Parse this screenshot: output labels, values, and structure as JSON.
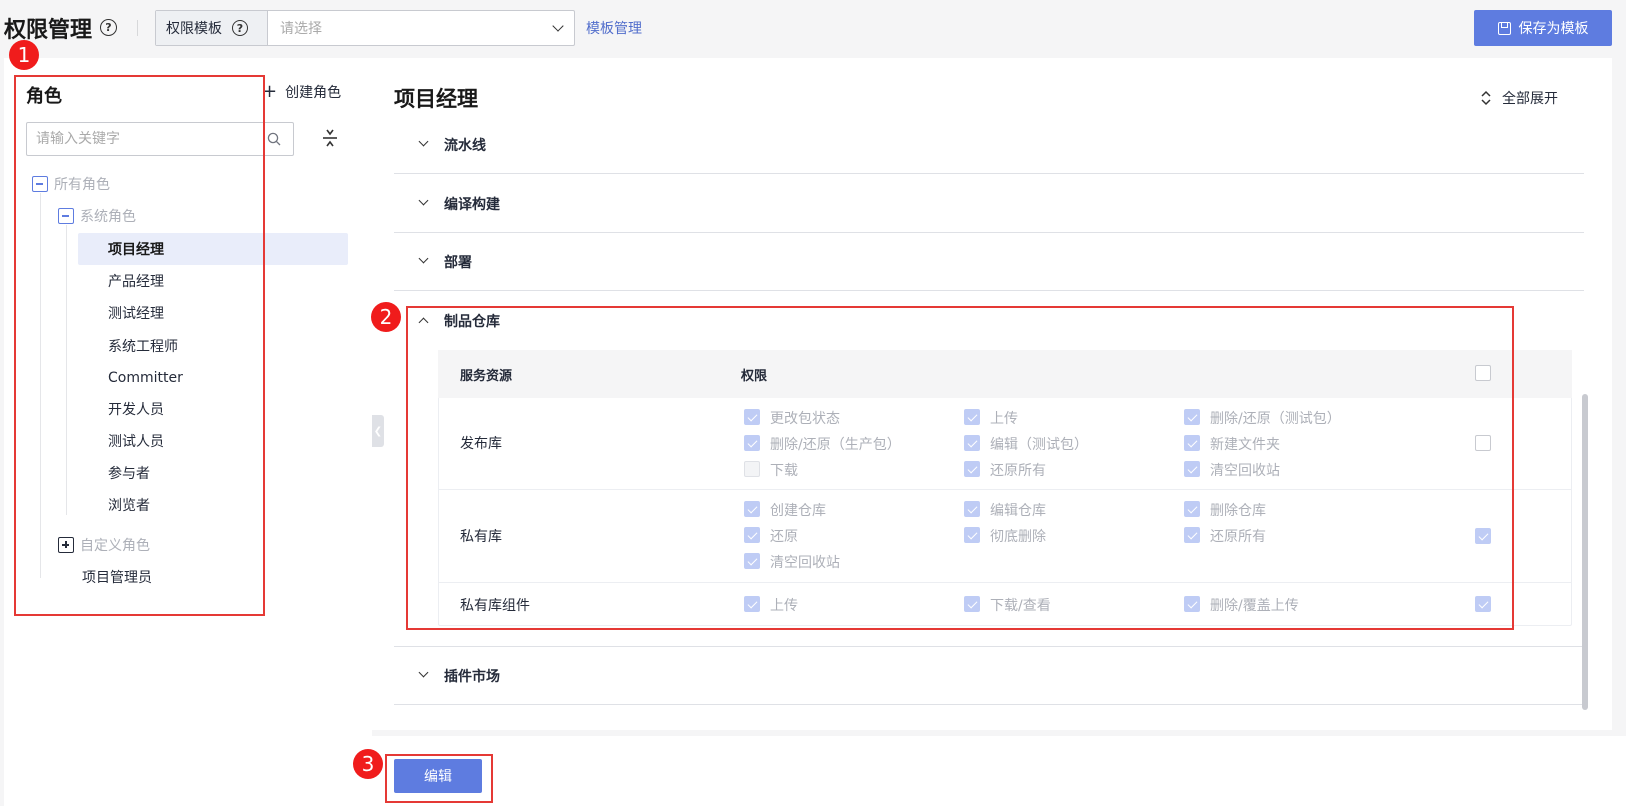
{
  "header": {
    "title": "权限管理",
    "template_label": "权限模板",
    "template_placeholder": "请选择",
    "template_manage": "模板管理",
    "save_as_template": "保存为模板"
  },
  "roles": {
    "title": "角色",
    "create_role": "创建角色",
    "search_placeholder": "请输入关键字",
    "root": "所有角色",
    "system_group": "系统角色",
    "system_roles": [
      "项目经理",
      "产品经理",
      "测试经理",
      "系统工程师",
      "Committer",
      "开发人员",
      "测试人员",
      "参与者",
      "浏览者"
    ],
    "selected_role": "项目经理",
    "custom_group": "自定义角色",
    "project_admin": "项目管理员"
  },
  "permissions": {
    "title": "项目经理",
    "expand_all": "全部展开",
    "sections": [
      "流水线",
      "编译构建",
      "部署",
      "制品仓库",
      "插件市场"
    ],
    "open_section": "制品仓库",
    "table_headers": [
      "服务资源",
      "权限"
    ],
    "rows": [
      {
        "resource": "发布库",
        "all_checked": false,
        "perms": [
          {
            "label": "更改包状态",
            "checked": true
          },
          {
            "label": "上传",
            "checked": true
          },
          {
            "label": "删除/还原（测试包）",
            "checked": true
          },
          {
            "label": "删除/还原（生产包）",
            "checked": true
          },
          {
            "label": "编辑（测试包）",
            "checked": true
          },
          {
            "label": "新建文件夹",
            "checked": true
          },
          {
            "label": "下载",
            "checked": false
          },
          {
            "label": "还原所有",
            "checked": true
          },
          {
            "label": "清空回收站",
            "checked": true
          }
        ]
      },
      {
        "resource": "私有库",
        "all_checked": true,
        "perms": [
          {
            "label": "创建仓库",
            "checked": true
          },
          {
            "label": "编辑仓库",
            "checked": true
          },
          {
            "label": "删除仓库",
            "checked": true
          },
          {
            "label": "还原",
            "checked": true
          },
          {
            "label": "彻底删除",
            "checked": true
          },
          {
            "label": "还原所有",
            "checked": true
          },
          {
            "label": "清空回收站",
            "checked": true
          }
        ]
      },
      {
        "resource": "私有库组件",
        "all_checked": true,
        "perms": [
          {
            "label": "上传",
            "checked": true
          },
          {
            "label": "下载/查看",
            "checked": true
          },
          {
            "label": "删除/覆盖上传",
            "checked": true
          }
        ]
      }
    ],
    "header_all_checked": false
  },
  "footer": {
    "edit": "编辑"
  },
  "annotations": [
    "1",
    "2",
    "3"
  ],
  "colors": {
    "primary": "#5e7ce0",
    "annotation": "#e53935",
    "selected_bg": "#e9edfa",
    "checked_disabled": "#bfccf5"
  }
}
